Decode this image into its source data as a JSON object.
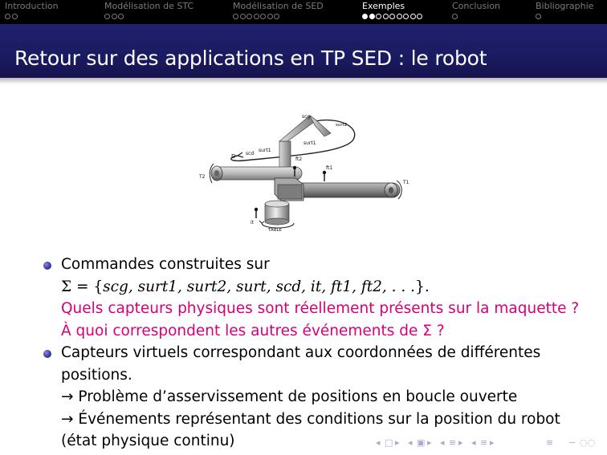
{
  "navbar": {
    "sections": [
      {
        "title": "Introduction",
        "dots": [
          0,
          0
        ],
        "active": false
      },
      {
        "title": "Modélisation de STC",
        "dots": [
          0,
          0,
          0
        ],
        "active": false
      },
      {
        "title": "Modélisation de SED",
        "dots": [
          0,
          0,
          0,
          0,
          0,
          0,
          0
        ],
        "active": false
      },
      {
        "title": "Exemples",
        "dots": [
          1,
          1,
          0,
          0,
          0,
          0,
          0,
          0,
          0
        ],
        "active": true
      },
      {
        "title": "Conclusion",
        "dots": [
          0
        ],
        "active": false
      },
      {
        "title": "Bibliographie",
        "dots": [
          0
        ],
        "active": false
      }
    ]
  },
  "slide": {
    "title": "Retour sur des applications en TP SED : le robot"
  },
  "figure": {
    "labels": {
      "scg": "scg",
      "surt2": "surt2",
      "surt1_top": "surt1",
      "surt1_left": "surt1",
      "scd": "scd",
      "d": "D",
      "ft2": "ft2",
      "ft1": "ft1",
      "t2": "T2",
      "t1": "T1",
      "it": "it",
      "table": "TABLE"
    }
  },
  "content": {
    "item1": {
      "line1": "Commandes construites sur",
      "set_prefix": "Σ = {",
      "set_elems": "scg, surt1, surt2, surt, scd, it, ft1, ft2, . . .",
      "set_suffix": "}.",
      "question1": "Quels capteurs physiques sont réellement présents sur la maquette ?",
      "question2": "À quoi correspondent les autres événements de Σ ?"
    },
    "item2": {
      "line1": "Capteurs virtuels correspondant aux coordonnées de différentes",
      "line2": "positions.",
      "line3": "→ Problème d’asservissement de positions en boucle ouverte",
      "line4": "→ Événements représentant des conditions sur la position du robot",
      "line5": "(état physique continu)"
    }
  },
  "colors": {
    "navbar_bg": "#000000",
    "title_bg": "#1a1a60",
    "alert": "#d6007a",
    "bullet": "#3a3aa0"
  }
}
